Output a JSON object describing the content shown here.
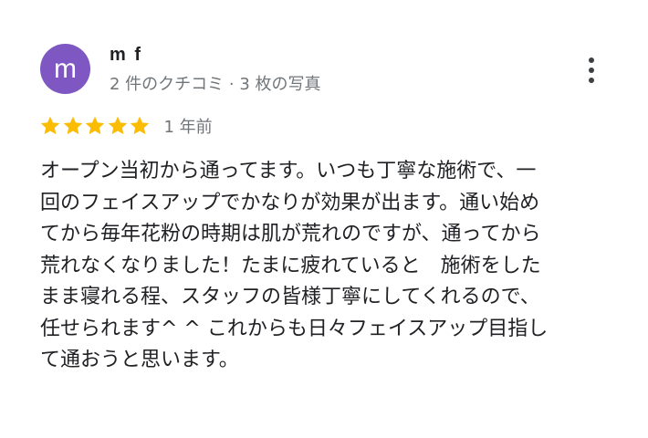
{
  "author": {
    "initial": "m",
    "name": "m f",
    "meta": "2 件のクチコミ · 3 枚の写真",
    "avatar_color": "#7e57c2"
  },
  "rating": {
    "stars": 5,
    "max": 5,
    "star_color": "#fbbc04",
    "date": "1 年前"
  },
  "review": {
    "lines": [
      "オープン当初から通ってます。いつも丁寧な施術で、一",
      "回のフェイスアップでかなりが効果が出ます。通い始め",
      "てから毎年花粉の時期は肌が荒れのですが、通ってから",
      "荒れなくなりました！たまに疲れていると　施術をした",
      "まま寝れる程、スタッフの皆様丁寧にしてくれるので、",
      "任せられます^ ^ これからも日々フェイスアップ目指し",
      "て通おうと思います。"
    ]
  },
  "icons": {
    "more": "more-vert-icon",
    "star": "star-icon"
  }
}
